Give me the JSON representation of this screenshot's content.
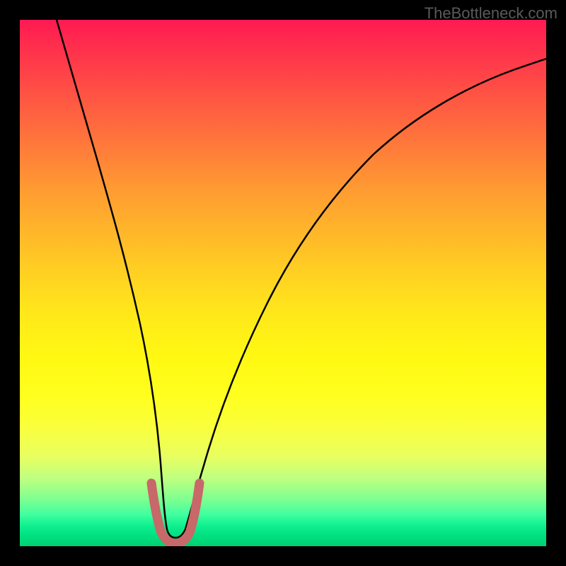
{
  "watermark": "TheBottleneck.com",
  "chart_data": {
    "type": "line",
    "title": "",
    "xlabel": "",
    "ylabel": "",
    "xlim": [
      0,
      100
    ],
    "ylim": [
      0,
      100
    ],
    "series": [
      {
        "name": "main-curve",
        "color": "#000000",
        "x": [
          7,
          10,
          13,
          16,
          19,
          22,
          24,
          26,
          27,
          28,
          29,
          30,
          31,
          32,
          34,
          37,
          41,
          46,
          52,
          59,
          67,
          76,
          86,
          96,
          100
        ],
        "y": [
          100,
          88,
          76,
          64,
          52,
          40,
          28,
          18,
          11,
          6,
          3,
          2,
          2,
          3,
          7,
          14,
          23,
          33,
          43,
          53,
          62,
          70,
          77,
          83,
          85
        ]
      },
      {
        "name": "bottom-segment",
        "color": "#c86464",
        "x": [
          25,
          26,
          27,
          28,
          29,
          30,
          31,
          32,
          33,
          34
        ],
        "y": [
          12,
          7,
          3,
          2,
          1.5,
          1.5,
          2,
          3,
          6,
          10
        ]
      }
    ],
    "background_gradient": {
      "type": "vertical",
      "stops": [
        {
          "pos": 0,
          "color": "#ff1a52"
        },
        {
          "pos": 50,
          "color": "#ffe020"
        },
        {
          "pos": 100,
          "color": "#00d070"
        }
      ]
    }
  }
}
